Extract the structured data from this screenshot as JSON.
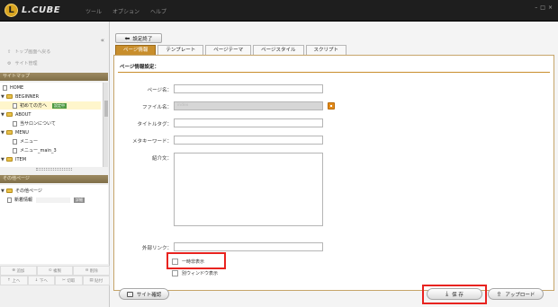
{
  "titlebar": {
    "logo": "L",
    "brand": "L.CUBE",
    "menu": [
      "ツール",
      "オプション",
      "ヘルプ"
    ],
    "window_controls": [
      "–",
      "□",
      "×"
    ]
  },
  "sidebar": {
    "collapse": "«",
    "nav": [
      {
        "icon": "arrow-icon",
        "label": "トップ画面へ戻る"
      },
      {
        "icon": "gear-icon",
        "label": "サイト管理"
      }
    ],
    "sitemap_header": "サイトマップ",
    "tree": [
      {
        "type": "page",
        "level": 0,
        "label": "HOME"
      },
      {
        "type": "folder",
        "level": 0,
        "label": "BEGINNER"
      },
      {
        "type": "page",
        "level": 1,
        "label": "初めての方へ",
        "badge": "設定中",
        "selected": true
      },
      {
        "type": "folder",
        "level": 0,
        "label": "ABOUT"
      },
      {
        "type": "page",
        "level": 1,
        "label": "当サロンについて"
      },
      {
        "type": "folder",
        "level": 0,
        "label": "MENU"
      },
      {
        "type": "page",
        "level": 1,
        "label": "メニュー"
      },
      {
        "type": "page",
        "level": 1,
        "label": "メニュー_main_3"
      },
      {
        "type": "folder",
        "level": 0,
        "label": "ITEM"
      }
    ],
    "other_header": "その他ページ",
    "other_tree": [
      {
        "type": "folder",
        "level": 0,
        "label": "その他ページ"
      },
      {
        "type": "page",
        "level": 1,
        "label": "新着情報",
        "badge": "詳細"
      }
    ],
    "tools_row1": [
      "追加",
      "複製",
      "削除"
    ],
    "tools_row2": [
      "上へ",
      "下へ",
      "切取",
      "貼付"
    ]
  },
  "main": {
    "finish_button": "設定終了",
    "tabs": [
      "ページ情報",
      "テンプレート",
      "ページテーマ",
      "ページスタイル",
      "スクリプト"
    ],
    "active_tab": 0,
    "section_title": "ページ情報設定：",
    "fields": {
      "page_name_label": "ページ名：",
      "file_name_label": "ファイル名：",
      "file_name_value": "index",
      "title_tag_label": "タイトルタグ：",
      "meta_keyword_label": "メタキーワード：",
      "description_label": "紹介文：",
      "external_link_label": "外部リンク："
    },
    "checkboxes": {
      "temp_hide": "一時非表示",
      "new_window": "別ウィンドウ表示"
    },
    "bottom": {
      "site_check": "サイト確認",
      "save": "保 存",
      "upload": "アップロード"
    }
  },
  "colors": {
    "accent": "#c88e2c",
    "highlight_box": "#e8231f",
    "titlebar": "#1e1e1e",
    "badge_green": "#4f9b43"
  }
}
